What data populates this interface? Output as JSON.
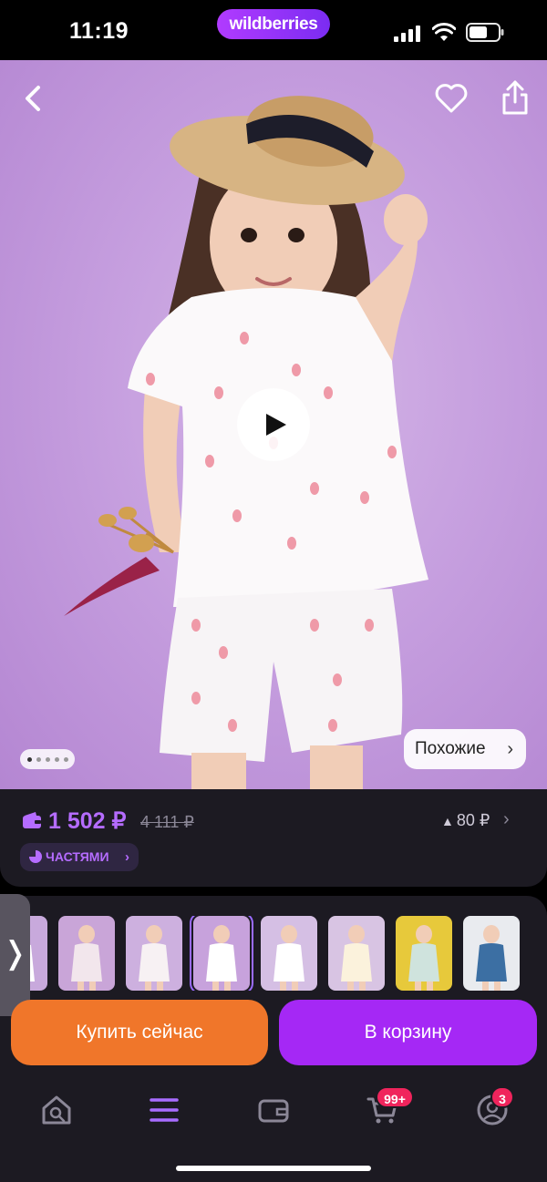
{
  "status_bar": {
    "time": "11:19",
    "brand": "wildberries"
  },
  "product": {
    "image_count": 5,
    "active_image": 1,
    "similar_label": "Похожие",
    "price": "1 502 ₽",
    "old_price": "4 111 ₽",
    "cashback": "80 ₽",
    "installments_label": "ЧАСТЯМИ"
  },
  "thumbnails": [
    {
      "name": "thumb-1",
      "bg": "#c8a9dc",
      "dress": "#ffffff",
      "selected": false
    },
    {
      "name": "thumb-2",
      "bg": "#c9a5d8",
      "dress": "#f2e6ec",
      "selected": false
    },
    {
      "name": "thumb-3",
      "bg": "#cdb0df",
      "dress": "#f7f1f3",
      "selected": false
    },
    {
      "name": "thumb-4",
      "bg": "#c7a2dc",
      "dress": "#ffffff",
      "selected": true
    },
    {
      "name": "thumb-5",
      "bg": "#d5bfe4",
      "dress": "#ffffff",
      "selected": false
    },
    {
      "name": "thumb-6",
      "bg": "#d8c4e3",
      "dress": "#fbf2dc",
      "selected": false
    },
    {
      "name": "thumb-7",
      "bg": "#e7c93b",
      "dress": "#cfe3dd",
      "selected": false
    },
    {
      "name": "thumb-8",
      "bg": "#e9ebef",
      "dress": "#3c6fa3",
      "selected": false
    }
  ],
  "actions": {
    "buy_now": "Купить сейчас",
    "add_to_cart": "В корзину"
  },
  "tab_bar": {
    "items": [
      {
        "name": "home-search",
        "icon": "home-search-icon"
      },
      {
        "name": "catalog",
        "icon": "menu-icon"
      },
      {
        "name": "wallet",
        "icon": "wallet-icon"
      },
      {
        "name": "cart",
        "icon": "cart-icon",
        "badge": "99+"
      },
      {
        "name": "profile",
        "icon": "profile-icon",
        "badge": "3"
      }
    ]
  },
  "colors": {
    "accent_purple": "#b56cff",
    "buy_orange": "#f0762a",
    "cart_purple": "#a528f5",
    "badge_red": "#f0245c"
  }
}
